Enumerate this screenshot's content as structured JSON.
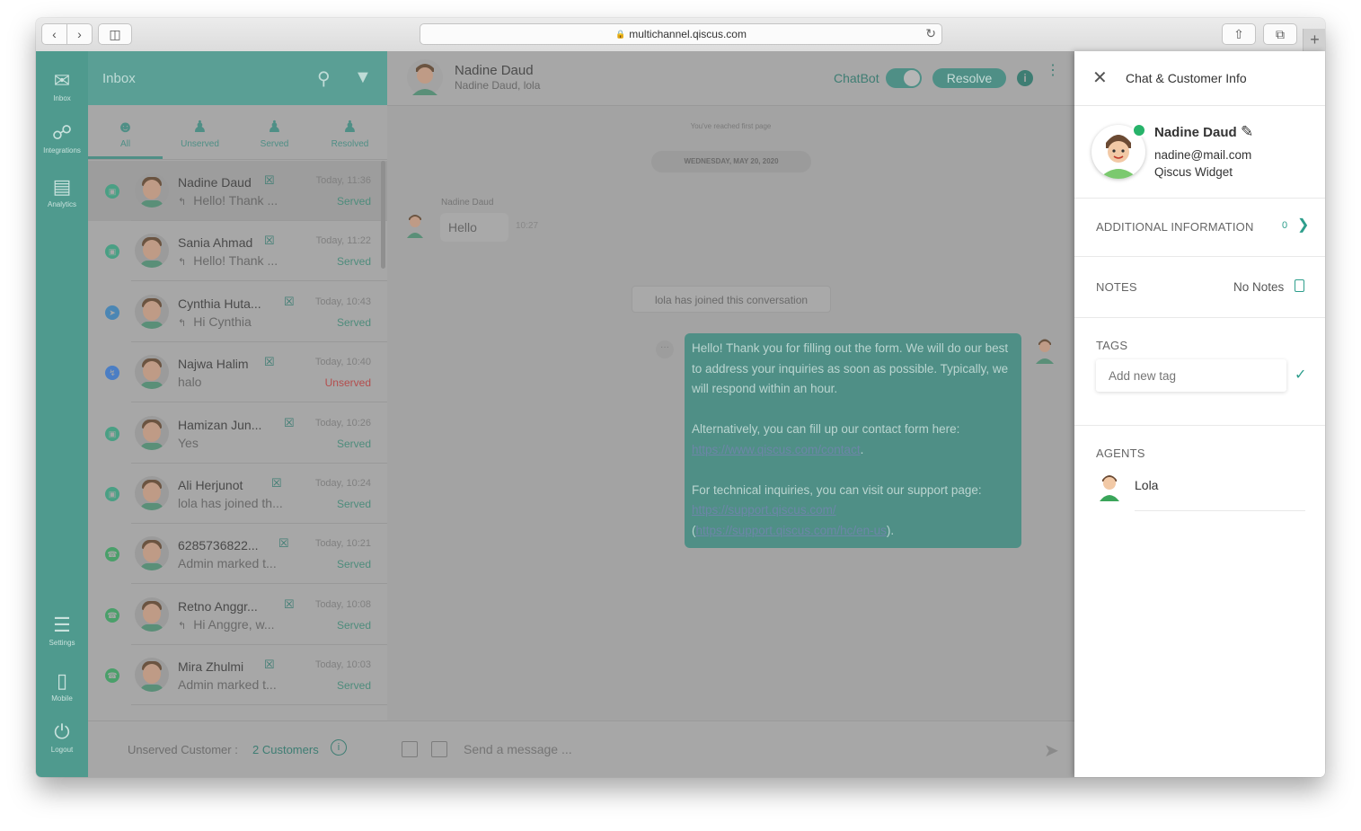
{
  "browser": {
    "url": "multichannel.qiscus.com",
    "new_tab": "+"
  },
  "rail": {
    "items": [
      {
        "label": "Inbox",
        "icon": "inbox-icon"
      },
      {
        "label": "Integrations",
        "icon": "integrations-icon"
      },
      {
        "label": "Analytics",
        "icon": "analytics-icon"
      },
      {
        "label": "Settings",
        "icon": "settings-icon"
      },
      {
        "label": "Mobile",
        "icon": "mobile-icon"
      },
      {
        "label": "Logout",
        "icon": "logout-icon"
      }
    ]
  },
  "inbox": {
    "title": "Inbox",
    "filters": [
      {
        "label": "All",
        "icon": "all-icon",
        "active": true
      },
      {
        "label": "Unserved",
        "icon": "unserved-icon"
      },
      {
        "label": "Served",
        "icon": "served-icon"
      },
      {
        "label": "Resolved",
        "icon": "resolved-icon"
      }
    ],
    "conversations": [
      {
        "name": "Nadine Daud",
        "preview": "Hello! Thank ...",
        "time": "Today, 11:36",
        "status": "Served",
        "reply": true,
        "channel": "qiscus",
        "selected": true
      },
      {
        "name": "Sania Ahmad",
        "preview": "Hello! Thank ...",
        "time": "Today, 11:22",
        "status": "Served",
        "reply": true,
        "channel": "qiscus"
      },
      {
        "name": "Cynthia Huta...",
        "preview": "Hi Cynthia",
        "time": "Today, 10:43",
        "status": "Served",
        "reply": true,
        "channel": "telegram"
      },
      {
        "name": "Najwa Halim",
        "preview": "halo",
        "time": "Today, 10:40",
        "status": "Unserved",
        "reply": false,
        "channel": "messenger"
      },
      {
        "name": "Hamizan Jun...",
        "preview": "Yes",
        "time": "Today, 10:26",
        "status": "Served",
        "reply": false,
        "channel": "qiscus"
      },
      {
        "name": "Ali Herjunot",
        "preview": "lola has joined th...",
        "time": "Today, 10:24",
        "status": "Served",
        "reply": false,
        "channel": "qiscus"
      },
      {
        "name": "6285736822...",
        "preview": "Admin marked t...",
        "time": "Today, 10:21",
        "status": "Served",
        "reply": false,
        "channel": "whatsapp"
      },
      {
        "name": "Retno Anggr...",
        "preview": "Hi Anggre, w...",
        "time": "Today, 10:08",
        "status": "Served",
        "reply": true,
        "channel": "whatsapp"
      },
      {
        "name": "Mira Zhulmi",
        "preview": "Admin marked t...",
        "time": "Today, 10:03",
        "status": "Served",
        "reply": false,
        "channel": "whatsapp"
      }
    ],
    "footer": {
      "label": "Unserved Customer :",
      "count": "2 Customers"
    }
  },
  "chat": {
    "name": "Nadine Daud",
    "participants": "Nadine Daud, lola",
    "chatbot_label": "ChatBot",
    "resolve_label": "Resolve",
    "first_page": "You've reached first page",
    "date": "WEDNESDAY, MAY 20, 2020",
    "incoming": {
      "sender": "Nadine Daud",
      "text": "Hello",
      "time": "10:27"
    },
    "system": "lola has joined this conversation",
    "outgoing": {
      "p1": "Hello! Thank you for filling out the form. We will do our best to address your inquiries as soon as possible. Typically, we will respond within an hour.",
      "p2": "Alternatively, you can fill up our contact form here:",
      "link1": "https://www.qiscus.com/contact",
      "p3": "For technical inquiries, you can visit our support page:",
      "link2": "https://support.qiscus.com/",
      "link3": "https://support.qiscus.com/hc/en-us",
      "open_paren": "(",
      "end_dot": ".",
      "close_paren": ")."
    },
    "composer_placeholder": "Send a message ..."
  },
  "info_panel": {
    "title": "Chat & Customer Info",
    "customer": {
      "name": "Nadine Daud",
      "email": "nadine@mail.com",
      "source": "Qiscus Widget"
    },
    "additional_label": "ADDITIONAL INFORMATION",
    "additional_count": "0",
    "notes_label": "NOTES",
    "notes_value": "No Notes",
    "tags_label": "TAGS",
    "tag_placeholder": "Add new tag",
    "agents_label": "AGENTS",
    "agents": [
      {
        "name": "Lola"
      }
    ]
  },
  "colors": {
    "accent": "#2e9e8c",
    "overlay_teal": "#4f9a8e",
    "unserved": "#b44d4d"
  }
}
